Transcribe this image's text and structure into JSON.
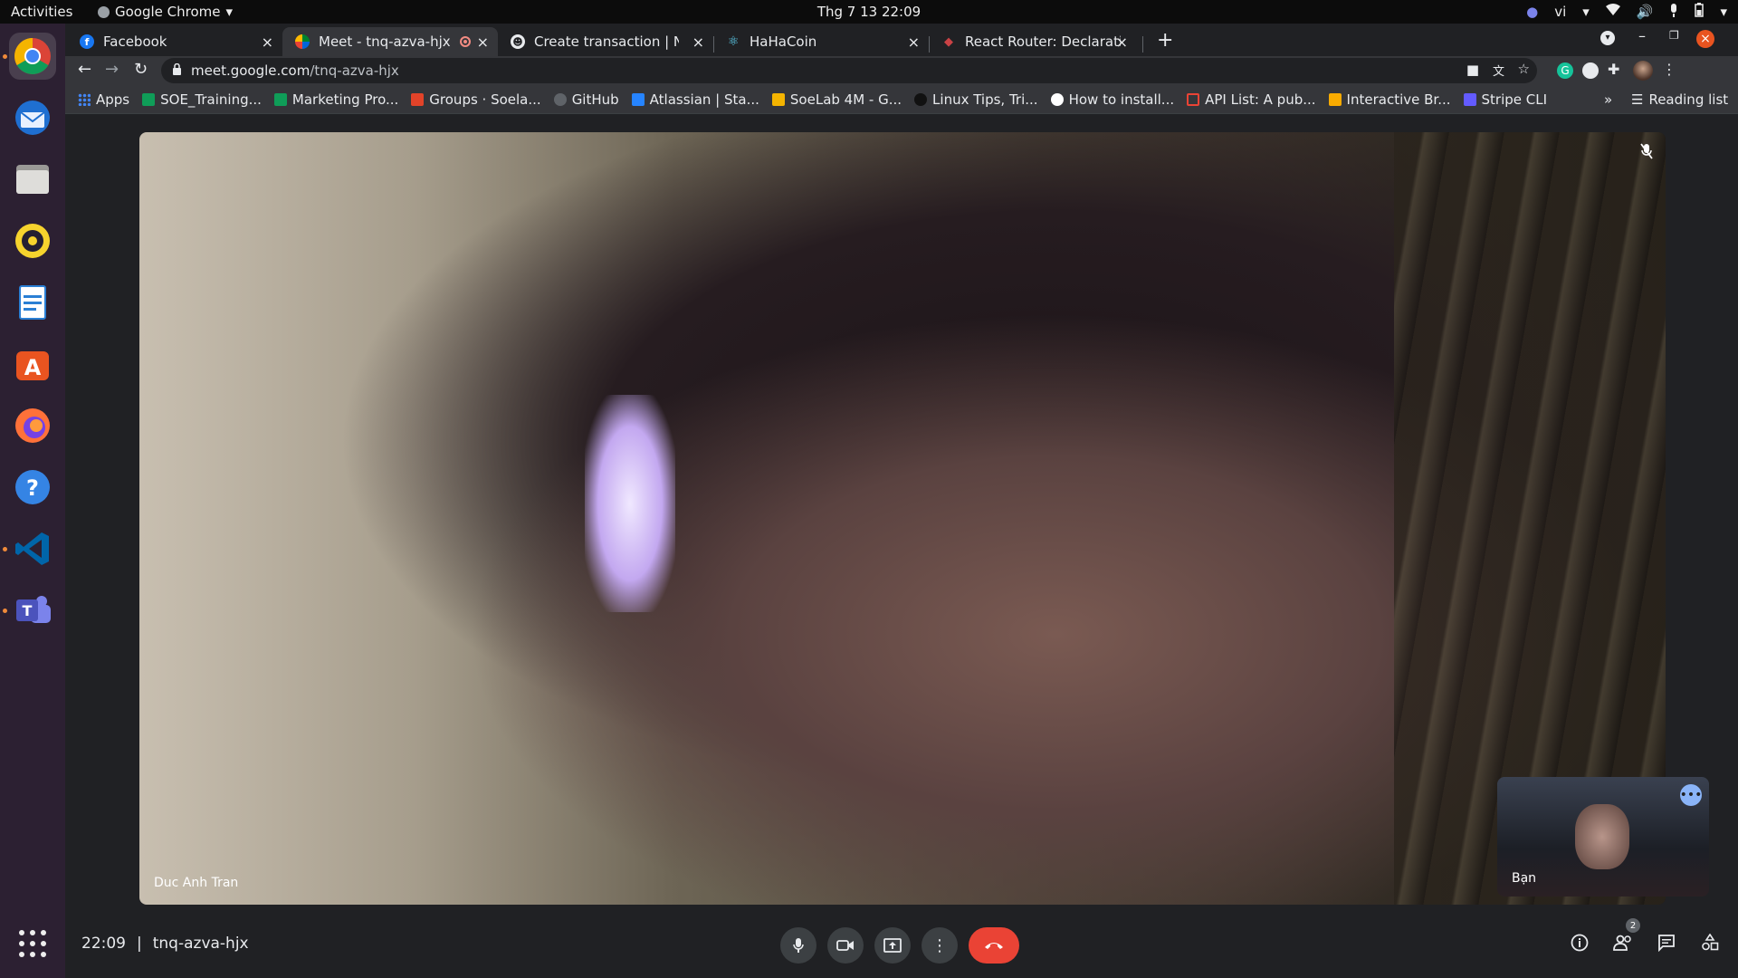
{
  "os": {
    "activities": "Activities",
    "app_name": "Google Chrome",
    "clock": "Thg 7 13  22:09",
    "input_method": "vi"
  },
  "tabs": [
    {
      "title": "Facebook",
      "color": "#1877f2",
      "icon": "facebook-icon"
    },
    {
      "title": "Meet - tnq-azva-hjx",
      "color": "#00832d",
      "icon": "meet-icon",
      "active": true
    },
    {
      "title": "Create transaction | New",
      "color": "#e8eaed",
      "icon": "globe-icon"
    },
    {
      "title": "HaHaCoin",
      "color": "#61dafb",
      "icon": "react-icon"
    },
    {
      "title": "React Router: Declarative",
      "color": "#ca4245",
      "icon": "react-router-icon"
    }
  ],
  "omnibox": {
    "url_host": "meet.google.com",
    "url_path": "/tnq-azva-hjx"
  },
  "bookmarks": [
    {
      "label": "Apps",
      "color": "#4285f4"
    },
    {
      "label": "SOE_Training...",
      "color": "#0f9d58"
    },
    {
      "label": "Marketing Pro...",
      "color": "#0f9d58"
    },
    {
      "label": "Groups · Soela...",
      "color": "#e24329"
    },
    {
      "label": "GitHub",
      "color": "#5f6368"
    },
    {
      "label": "Atlassian | Sta...",
      "color": "#2684ff"
    },
    {
      "label": "SoeLab 4M - G...",
      "color": "#f4b400"
    },
    {
      "label": "Linux Tips, Tri...",
      "color": "#3c3c3c"
    },
    {
      "label": "How to install...",
      "color": "#ffffff"
    },
    {
      "label": "API List: A pub...",
      "color": "#ea4335"
    },
    {
      "label": "Interactive Br...",
      "color": "#f9ab00"
    },
    {
      "label": "Stripe CLI",
      "color": "#635bff"
    }
  ],
  "reading_list": "Reading list",
  "meet": {
    "participant_name": "Duc Anh Tran",
    "self_name": "Bạn",
    "time": "22:09",
    "meeting_code": "tnq-azva-hjx",
    "participants_count": "2",
    "end_call_color": "#ea4335"
  }
}
